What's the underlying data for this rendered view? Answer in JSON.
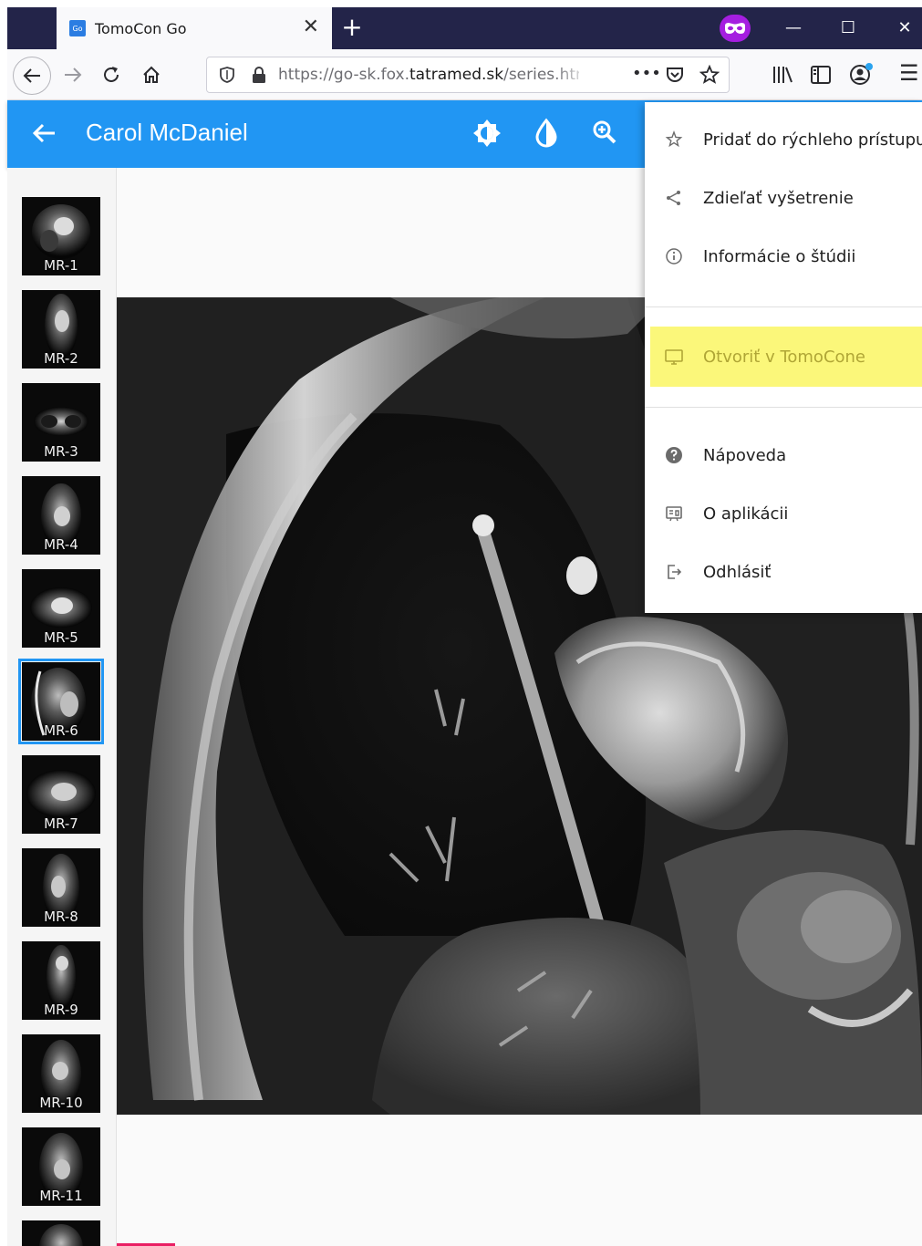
{
  "browser": {
    "tab_title": "TomoCon Go",
    "favicon_text": "Go",
    "tab_close": "✕",
    "new_tab": "+",
    "url_prefix": "https://go-sk.fox.",
    "url_domain": "tatramed.sk",
    "url_path": "/series.html",
    "page_actions": "•••",
    "window_controls": {
      "minimize": "—",
      "maximize": "☐",
      "close": "✕"
    },
    "hamburger": "☰"
  },
  "header": {
    "patient_name": "Carol McDaniel",
    "accent_color": "#2196f3"
  },
  "series": [
    {
      "label": "MR-1",
      "selected": false
    },
    {
      "label": "MR-2",
      "selected": false
    },
    {
      "label": "MR-3",
      "selected": false
    },
    {
      "label": "MR-4",
      "selected": false
    },
    {
      "label": "MR-5",
      "selected": false
    },
    {
      "label": "MR-6",
      "selected": true
    },
    {
      "label": "MR-7",
      "selected": false
    },
    {
      "label": "MR-8",
      "selected": false
    },
    {
      "label": "MR-9",
      "selected": false
    },
    {
      "label": "MR-10",
      "selected": false
    },
    {
      "label": "MR-11",
      "selected": false
    }
  ],
  "menu": {
    "items": [
      {
        "label": "Pridať do rýchleho prístupu",
        "icon": "star-outline-icon"
      },
      {
        "label": "Zdieľať vyšetrenie",
        "icon": "share-icon"
      },
      {
        "label": "Informácie o štúdii",
        "icon": "info-icon"
      },
      {
        "label": "Otvoriť v TomoCone",
        "icon": "monitor-icon",
        "highlighted": true,
        "highlight_color": "#fbf77a",
        "text_color": "#b0a636"
      },
      {
        "label": "Nápoveda",
        "icon": "help-icon"
      },
      {
        "label": "O aplikácii",
        "icon": "about-icon"
      },
      {
        "label": "Odhlásiť",
        "icon": "logout-icon"
      }
    ]
  }
}
